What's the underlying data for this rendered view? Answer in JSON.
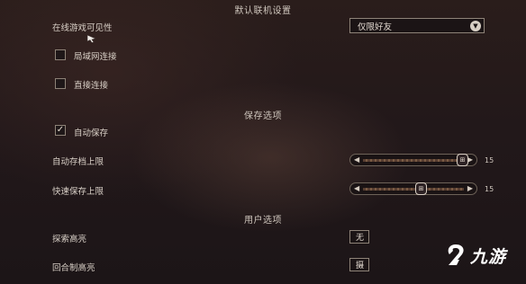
{
  "sections": {
    "online": "默认联机设置",
    "save": "保存选项",
    "user": "用户选项"
  },
  "online_visibility": {
    "label": "在线游戏可见性",
    "value": "仅限好友"
  },
  "checkboxes": {
    "lan": {
      "label": "局域网连接",
      "checked": false
    },
    "direct": {
      "label": "直接连接",
      "checked": false
    },
    "autosave": {
      "label": "自动保存",
      "checked": true
    }
  },
  "sliders": {
    "autosave_limit": {
      "label": "自动存档上限",
      "value": 15,
      "thumb_glyph": "⊞"
    },
    "quicksave_limit": {
      "label": "快速保存上限",
      "value": 15,
      "thumb_glyph": "⊞"
    }
  },
  "user_options": {
    "explore_highlight": {
      "label": "探索高亮",
      "value": "无"
    },
    "turn_highlight": {
      "label": "回合制高亮",
      "value": "摄"
    }
  },
  "watermark": {
    "text": "九游"
  },
  "colors": {
    "background": "#22181a",
    "text": "#d8cfc6",
    "accent": "#c99a70",
    "watermark": "#ffffff"
  }
}
